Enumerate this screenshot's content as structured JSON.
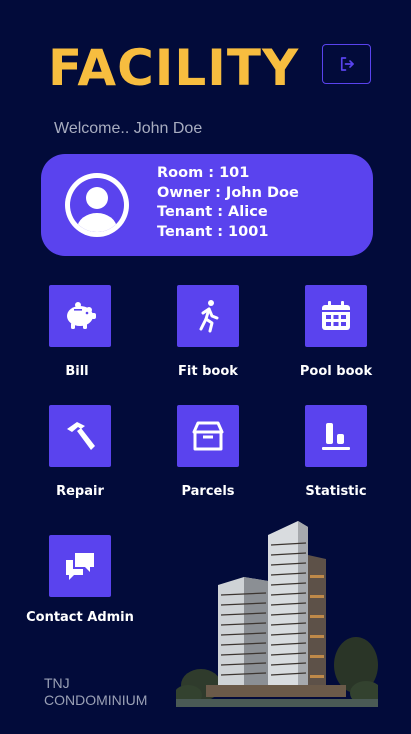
{
  "header": {
    "title": "FACILITY",
    "logout_icon": "logout-icon"
  },
  "welcome": {
    "text": "Welcome.. John Doe"
  },
  "profile": {
    "room": "Room  : 101",
    "owner": "Owner : John Doe",
    "tenant_name": "Tenant : Alice",
    "tenant_room": "Tenant : 1001"
  },
  "menu": [
    {
      "label": "Bill",
      "icon": "piggy-bank-icon"
    },
    {
      "label": "Fit book",
      "icon": "running-person-icon"
    },
    {
      "label": "Pool book",
      "icon": "calendar-icon"
    },
    {
      "label": "Repair",
      "icon": "hammer-icon"
    },
    {
      "label": "Parcels",
      "icon": "box-icon"
    },
    {
      "label": "Statistic",
      "icon": "bar-chart-icon"
    },
    {
      "label": "Contact Admin",
      "icon": "chat-icon"
    }
  ],
  "footer": {
    "line1": "TNJ",
    "line2": "CONDOMINIUM"
  },
  "colors": {
    "background": "#020b3a",
    "accent": "#5a43ee",
    "title": "#f7bd3f"
  }
}
